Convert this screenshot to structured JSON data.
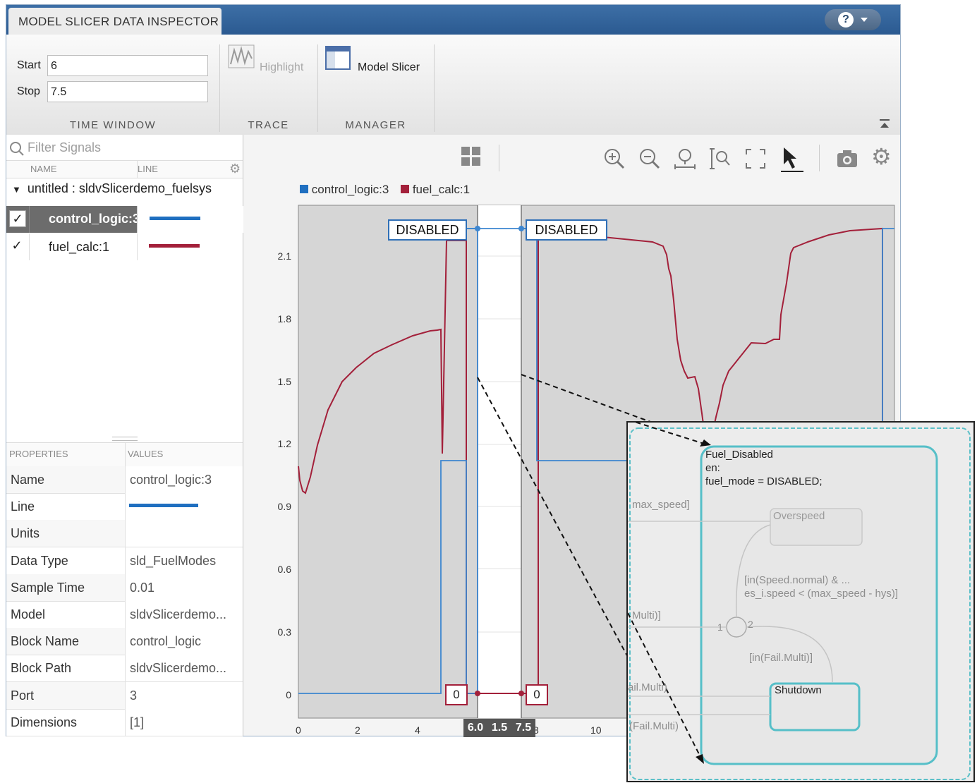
{
  "app": {
    "title": "MODEL SLICER DATA INSPECTOR",
    "help_label": "?"
  },
  "ribbon": {
    "start_label": "Start",
    "start_value": "6",
    "stop_label": "Stop",
    "stop_value": "7.5",
    "highlight_label": "Highlight",
    "model_slicer_label": "Model Slicer",
    "sections": [
      "TIME WINDOW",
      "TRACE",
      "MANAGER"
    ]
  },
  "signals": {
    "filter_placeholder": "Filter Signals",
    "col_name": "NAME",
    "col_line": "LINE",
    "group_label": "untitled : sldvSlicerdemo_fuelsys",
    "items": [
      {
        "name": "control_logic:3",
        "color": "#1f6fc0",
        "checked": true,
        "selected": true
      },
      {
        "name": "fuel_calc:1",
        "color": "#a3203a",
        "checked": true,
        "selected": false
      }
    ]
  },
  "properties": {
    "col_props": "PROPERTIES",
    "col_values": "VALUES",
    "rows": [
      {
        "key": "Name",
        "value": "control_logic:3"
      },
      {
        "key": "Line",
        "value": ""
      },
      {
        "key": "Units",
        "value": ""
      },
      {
        "key": "Data Type",
        "value": "sld_FuelModes"
      },
      {
        "key": "Sample Time",
        "value": "0.01"
      },
      {
        "key": "Model",
        "value": "sldvSlicerdemo..."
      },
      {
        "key": "Block Name",
        "value": "control_logic"
      },
      {
        "key": "Block Path",
        "value": "sldvSlicerdemo..."
      },
      {
        "key": "Port",
        "value": "3"
      },
      {
        "key": "Dimensions",
        "value": "[1]"
      }
    ]
  },
  "plot": {
    "legend": [
      {
        "name": "control_logic:3",
        "color": "#1f6fc0"
      },
      {
        "name": "fuel_calc:1",
        "color": "#a3203a"
      }
    ],
    "yticks": [
      "2.1",
      "1.8",
      "1.5",
      "1.2",
      "0.9",
      "0.6",
      "0.3",
      "0"
    ],
    "xticks": [
      "0",
      "2",
      "4",
      "8",
      "10"
    ],
    "cursor_label_left": "6.0",
    "cursor_label_mid": "1.5",
    "cursor_label_right": "7.5",
    "disabled_label": "DISABLED",
    "zero_label": "0"
  },
  "inset": {
    "state_title": "Fuel_Disabled",
    "state_en": "en:",
    "state_action": "fuel_mode = DISABLED;",
    "overspeed": "Overspeed",
    "shutdown": "Shutdown",
    "max_speed": "max_speed]",
    "cond1": "[in(Speed.normal) & ...",
    "cond2": "es_i.speed < (max_speed - hys)]",
    "multi": "Multi)]",
    "fail_multi_cond": "[in(Fail.Multi)]",
    "fail_multi_a": "ail.Multi)",
    "fail_multi_b": "(Fail.Multi)",
    "junction_in": "1",
    "junction_out": "2"
  }
}
